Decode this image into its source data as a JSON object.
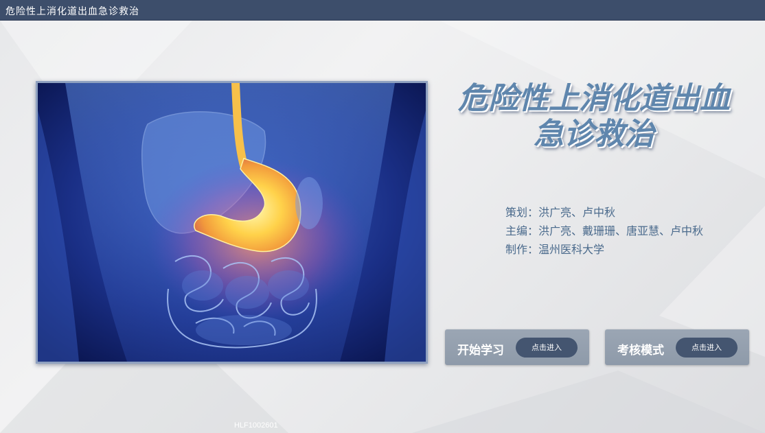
{
  "window": {
    "title": "危险性上消化道出血急诊救治"
  },
  "main": {
    "title_line1": "危险性上消化道出血",
    "title_line2": "急诊救治",
    "hero_image": "stomach-anatomy-illustration"
  },
  "credits": [
    {
      "text": "策划：洪广亮、卢中秋"
    },
    {
      "text": "主编：洪广亮、戴珊珊、唐亚慧、卢中秋"
    },
    {
      "text": "制作：温州医科大学"
    }
  ],
  "actions": {
    "study": {
      "label": "开始学习",
      "button": "点击进入"
    },
    "exam": {
      "label": "考核模式",
      "button": "点击进入"
    }
  },
  "footer": {
    "code": "HLF1002601"
  },
  "colors": {
    "titlebar": "#3d4e6b",
    "title_text": "#5f86ad",
    "credits_text": "#4a6a8c",
    "card_bg": "#95a0ae",
    "button_bg": "#445570"
  }
}
